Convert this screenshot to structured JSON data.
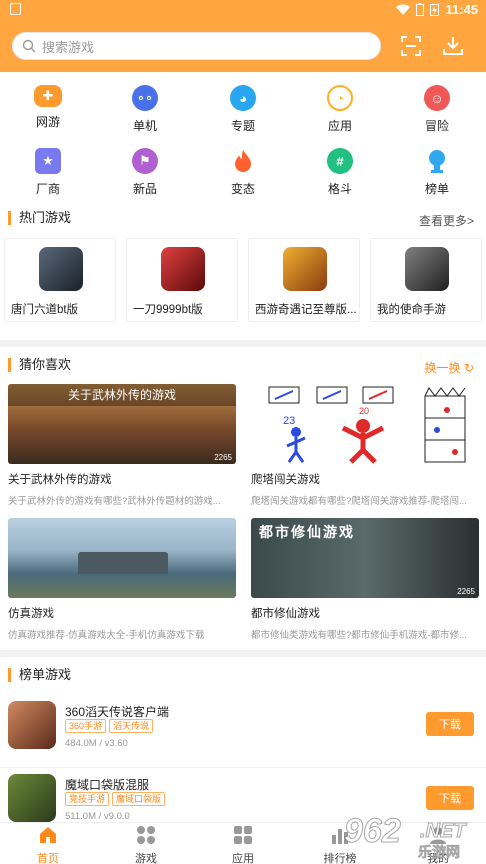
{
  "status": {
    "time": "11:45"
  },
  "search": {
    "placeholder": "搜索游戏"
  },
  "categories": [
    {
      "label": "网游",
      "icon": "gamepad-icon",
      "color": "#ff9a2e"
    },
    {
      "label": "单机",
      "icon": "controller-icon",
      "color": "#4a72e8"
    },
    {
      "label": "专题",
      "icon": "pacman-icon",
      "color": "#2aa6f0"
    },
    {
      "label": "应用",
      "icon": "pacman-outline-icon",
      "color": "#ffb020"
    },
    {
      "label": "冒险",
      "icon": "mask-icon",
      "color": "#f05858"
    },
    {
      "label": "厂商",
      "icon": "star-chat-icon",
      "color": "#7a7af0"
    },
    {
      "label": "新品",
      "icon": "flag-icon",
      "color": "#b060d0"
    },
    {
      "label": "变态",
      "icon": "flame-icon",
      "color": "#ff6030"
    },
    {
      "label": "格斗",
      "icon": "hash-icon",
      "color": "#20c080"
    },
    {
      "label": "榜单",
      "icon": "trophy-icon",
      "color": "#30a8f0"
    }
  ],
  "hot": {
    "title": "热门游戏",
    "more": "查看更多>",
    "items": [
      {
        "name": "唐门六道bt版",
        "thumb_color": "#2a3a4a"
      },
      {
        "name": "一刀9999bt版",
        "thumb_color": "#8a1a1a"
      },
      {
        "name": "西游奇遇记至尊版...",
        "thumb_color": "#c87a20"
      },
      {
        "name": "我的使命手游",
        "thumb_color": "#404040"
      }
    ]
  },
  "guess": {
    "title": "猜你喜欢",
    "refresh": "换一换",
    "items": [
      {
        "banner": "关于武林外传的游戏",
        "badge": "2265",
        "title": "关于武林外传的游戏",
        "desc": "关于武林外传的游戏有哪些?武林外传题材的游戏..."
      },
      {
        "banner": "",
        "badge": "",
        "title": "爬塔闯关游戏",
        "desc": "爬塔闯关游戏都有哪些?爬塔闯关游戏推荐-爬塔闯..."
      },
      {
        "banner": "",
        "badge": "",
        "title": "仿真游戏",
        "desc": "仿真游戏推荐-仿真游戏大全-手机仿真游戏下载"
      },
      {
        "banner": "都市修仙游戏",
        "badge": "2265",
        "title": "都市修仙游戏",
        "desc": "都市修仙类游戏有哪些?都市修仙手机游戏-都市修..."
      }
    ]
  },
  "rank": {
    "title": "榜单游戏",
    "items": [
      {
        "name": "360滔天传说客户端",
        "tags": [
          "360手游",
          "滔天传说"
        ],
        "meta": "484.0M / v3.60",
        "download": "下载"
      },
      {
        "name": "魔域口袋版混服",
        "tags": [
          "竞技手游",
          "魔域口袋版"
        ],
        "meta": "511.0M / v9.0.0",
        "download": "下载"
      }
    ]
  },
  "tabs": [
    {
      "label": "首页"
    },
    {
      "label": "游戏"
    },
    {
      "label": "应用"
    },
    {
      "label": "排行榜"
    },
    {
      "label": "我的"
    }
  ],
  "watermark": {
    "text": "962",
    "net": ".NET",
    "sub": "乐游网"
  },
  "colors": {
    "accent": "#ffa640",
    "button": "#ff9a2e"
  }
}
